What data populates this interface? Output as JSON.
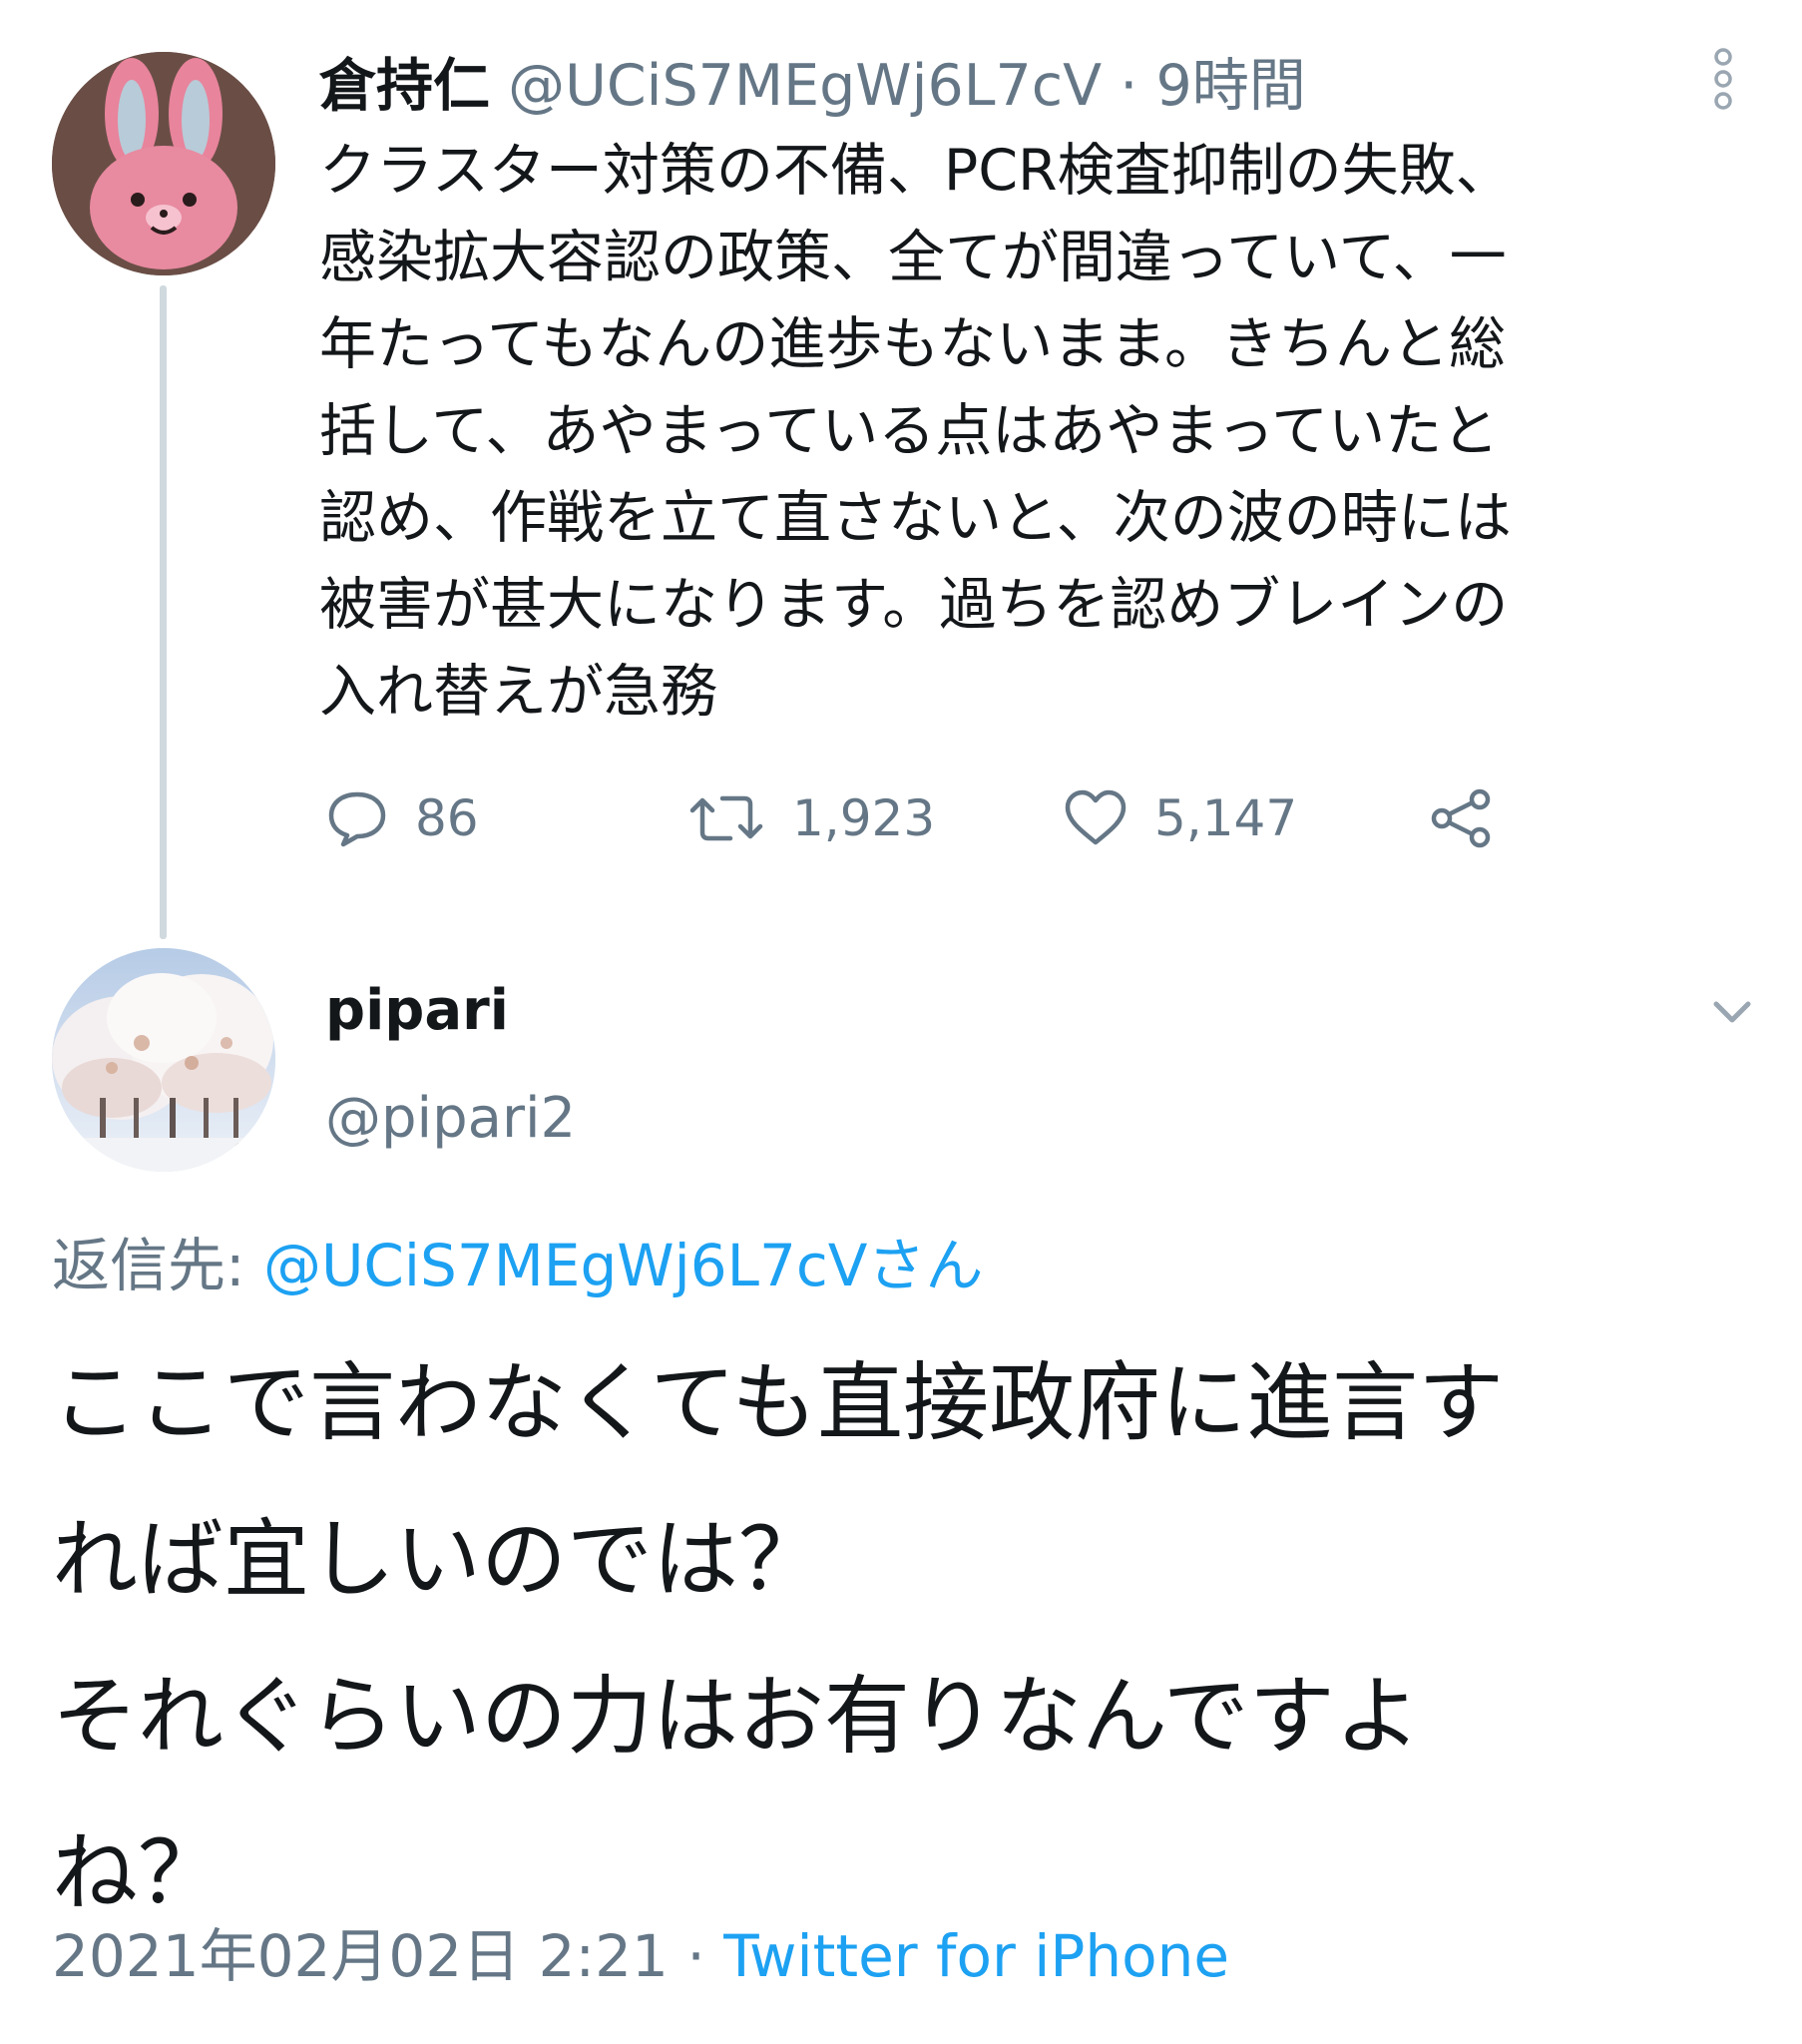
{
  "parent_tweet": {
    "name": "倉持仁",
    "handle": "@UCiS7MEgWj6L7cV",
    "separator": "·",
    "time": "9時間",
    "lines": [
      "クラスター対策の不備、PCR検査抑制の失敗、",
      "感染拡大容認の政策、全てが間違っていて、一",
      "年たってもなんの進歩もないまま。きちんと総",
      "括して、あやまっている点はあやまっていたと",
      "認め、作戦を立て直さないと、次の波の時には",
      "被害が甚大になります。過ちを認めブレインの",
      "入れ替えが急務"
    ],
    "replies": "86",
    "retweets": "1,923",
    "likes": "5,147",
    "avatar_icon": "pink-rabbit-avatar"
  },
  "reply_tweet": {
    "name": "pipari",
    "handle": "@pipari2",
    "reply_to_label": "返信先: ",
    "reply_to_handle": "@UCiS7MEgWj6L7cVさん",
    "lines": [
      "ここで言わなくても直接政府に進言す",
      "れば宜しいのでは？",
      "それぐらいの力はお有りなんですよ",
      "ね？"
    ],
    "date": "2021年02月02日 2:21",
    "separator": "·",
    "source": "Twitter for iPhone",
    "avatar_icon": "snowy-trees-avatar"
  },
  "colors": {
    "text": "#14171a",
    "secondary": "#657786",
    "link": "#1da1f2",
    "thread_line": "#cfd9de"
  },
  "icons": [
    "reply-icon",
    "retweet-icon",
    "like-icon",
    "share-icon",
    "more-icon",
    "chevron-down-icon"
  ]
}
